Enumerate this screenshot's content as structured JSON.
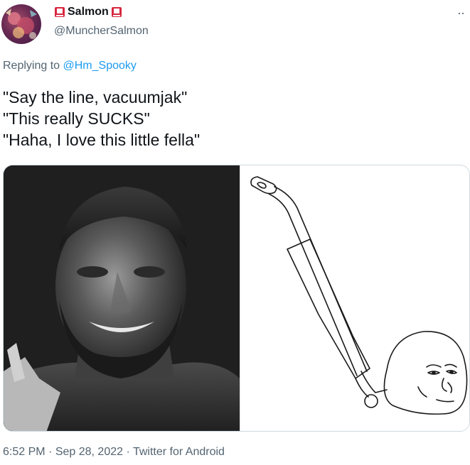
{
  "author": {
    "display_name": "Salmon",
    "handle": "@MuncherSalmon",
    "avatar_icon": "avatar-icon",
    "name_emoji": "flag-icon"
  },
  "reply": {
    "prefix": "Replying to",
    "mention": "@Hm_Spooky"
  },
  "tweet": {
    "lines": [
      "\"Say the line, vacuumjak\"",
      "\"This really SUCKS\"",
      "\"Haha, I love this little fella\""
    ]
  },
  "media": {
    "left_image": "gigachad-image",
    "right_image": "wojak-vacuum-drawing"
  },
  "footer": {
    "time": "6:52 PM",
    "separator": "·",
    "date": "Sep 28, 2022",
    "source": "Twitter for Android"
  },
  "colors": {
    "link": "#1d9bf0",
    "secondary_text": "#536471",
    "primary_text": "#0f1419"
  }
}
